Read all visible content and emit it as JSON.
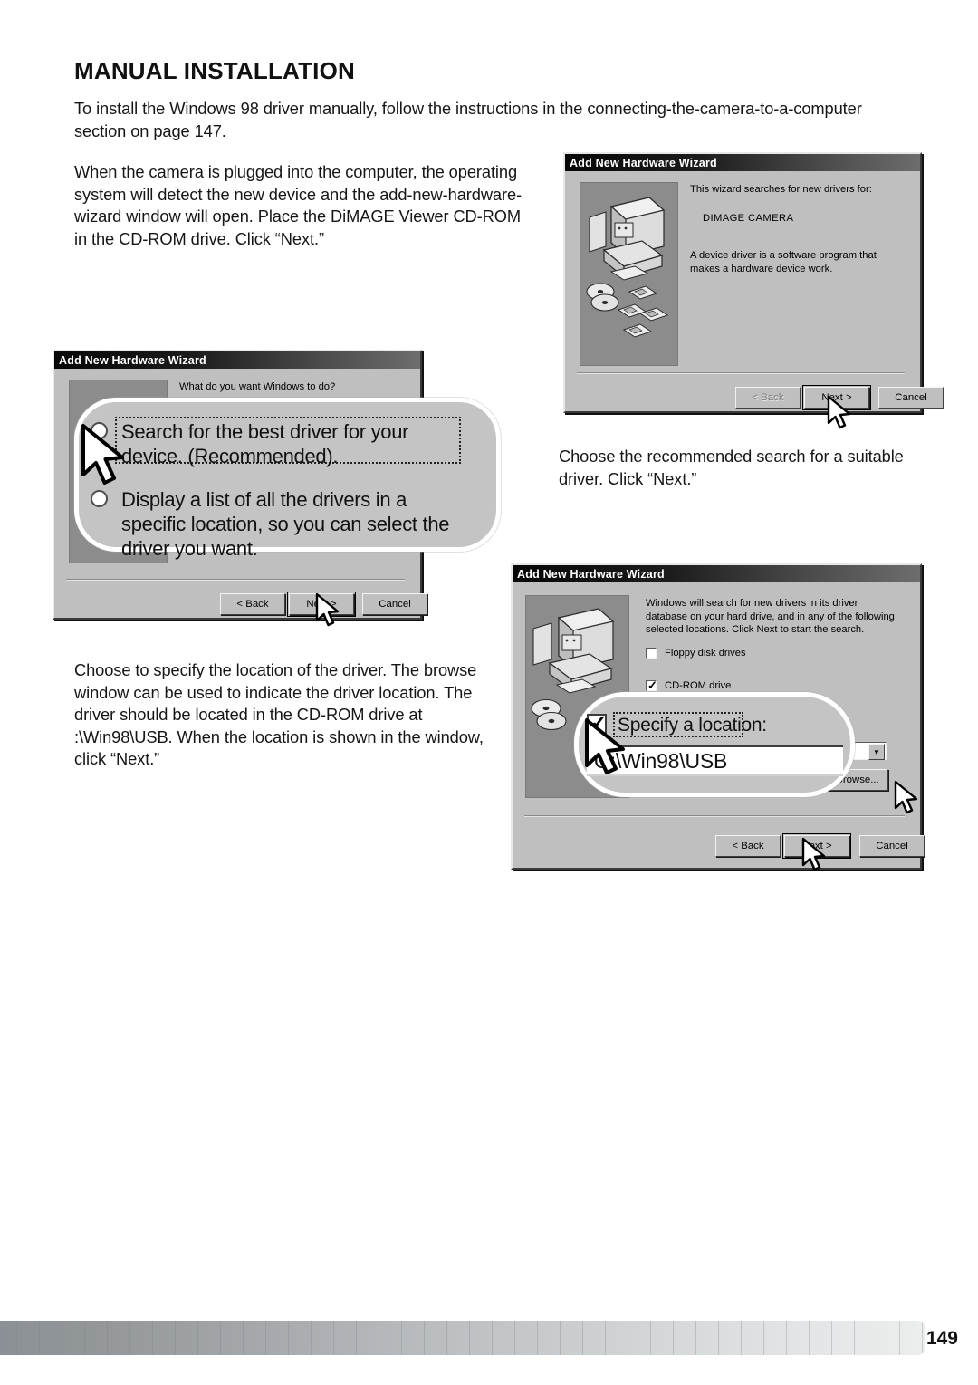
{
  "page": {
    "title": "MANUAL INSTALLATION",
    "number": "149"
  },
  "paragraphs": {
    "intro": "To install the Windows 98 driver manually, follow the instructions in the connecting-the-camera-to-a-computer section on page 147.",
    "plugged_in": "When the camera is plugged into the computer, the operating system will detect the new device and the add-new-hardware-wizard window will open. Place the DiMAGE Viewer CD-ROM in the CD-ROM drive. Click “Next.”",
    "choose_recommended": "Choose the recommended search for a suitable driver. Click “Next.”",
    "specify_location": "Choose to specify the location of the driver. The browse window can be used to indicate the driver location. The driver should be located in the CD-ROM drive at :\\Win98\\USB. When the location is shown in the window, click “Next.”"
  },
  "dialog1": {
    "title": "Add New Hardware Wizard",
    "line1": "This wizard searches for new drivers for:",
    "device": "DIMAGE CAMERA",
    "line2": "A device driver is a software program that makes a hardware device work.",
    "buttons": {
      "back": "< Back",
      "next": "Next >",
      "cancel": "Cancel"
    }
  },
  "dialog2": {
    "title": "Add New Hardware Wizard",
    "prompt": "What do you want Windows to do?",
    "option_search": "Search for the best driver for your device. (Recommended).",
    "option_display": "Display a list of all the drivers in a specific location, so you can select the driver you want.",
    "buttons": {
      "back": "< Back",
      "next": "Next >",
      "cancel": "Cancel"
    }
  },
  "dialog3": {
    "title": "Add New Hardware Wizard",
    "intro": "Windows will search for new drivers in its driver database on your hard drive, and in any of the following selected locations. Click Next to start the search.",
    "check_floppy": "Floppy disk drives",
    "check_cdrom": "CD-ROM drive",
    "check_specify": "Specify a location:",
    "location_value": "G:\\Win98\\USB",
    "buttons": {
      "browse": "Browse...",
      "back": "< Back",
      "next": "Next >",
      "cancel": "Cancel"
    }
  }
}
